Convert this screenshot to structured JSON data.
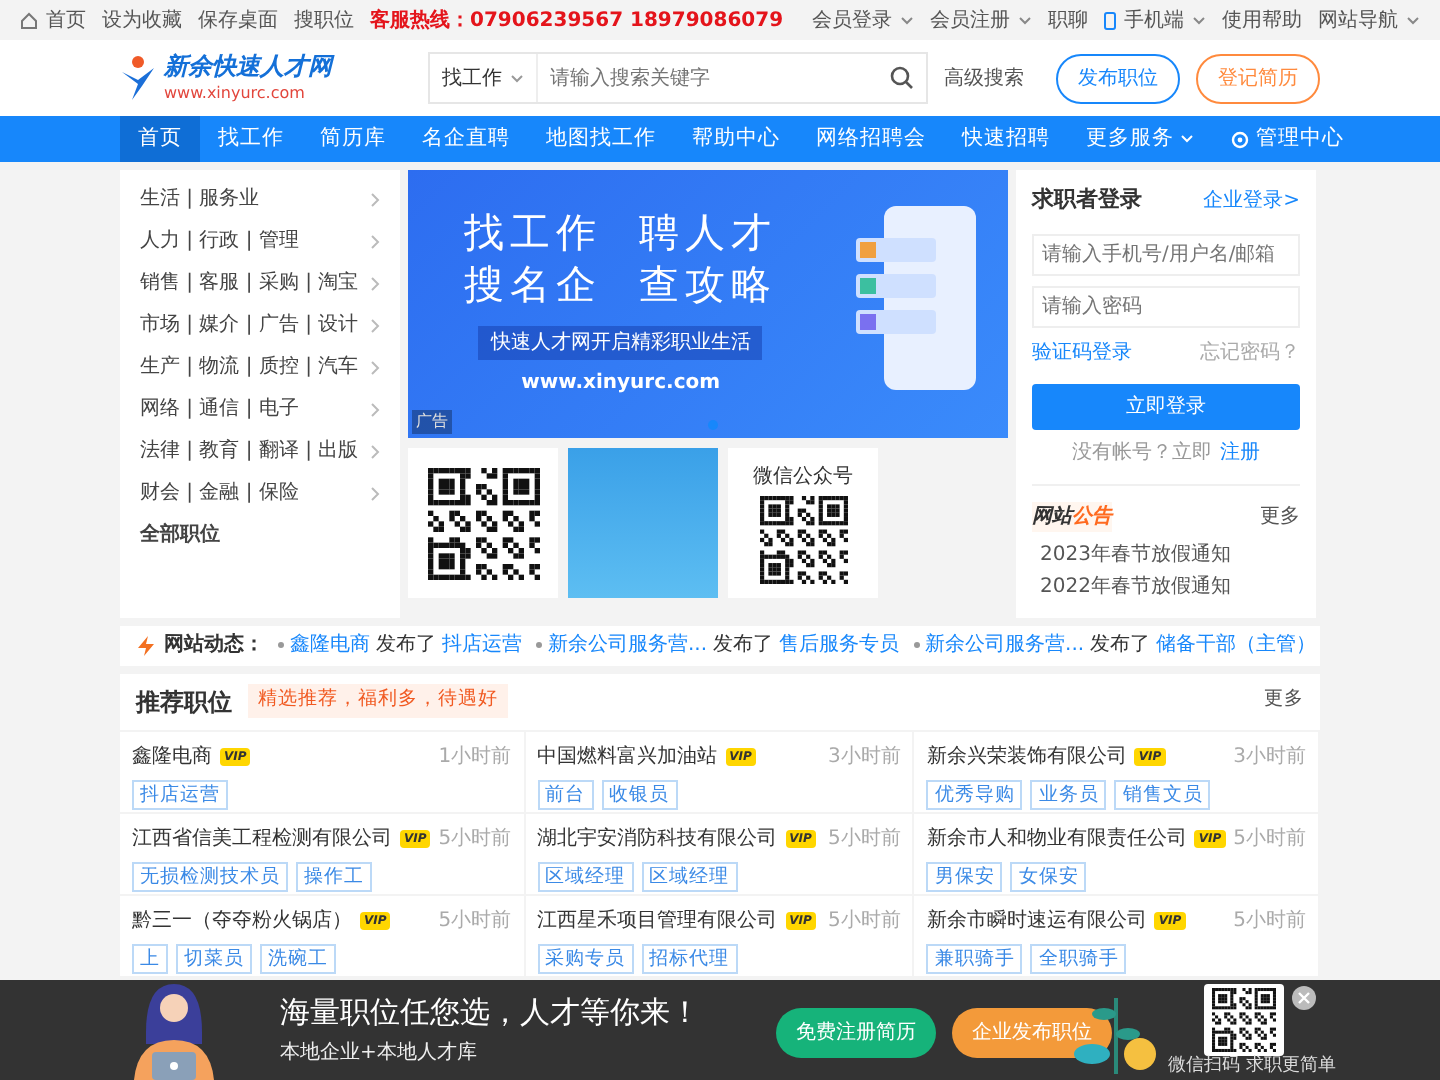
{
  "top_bar": {
    "left_links": [
      {
        "label": "首页"
      },
      {
        "label": "设为收藏"
      },
      {
        "label": "保存桌面"
      },
      {
        "label": "搜职位"
      }
    ],
    "hotline": "客服热线：07906239567 18979086079",
    "right_links": [
      {
        "label": "会员登录",
        "dropdown": true
      },
      {
        "label": "会员注册",
        "dropdown": true
      },
      {
        "label": "职聊",
        "dropdown": false
      },
      {
        "label": "手机端",
        "dropdown": true
      },
      {
        "label": "使用帮助",
        "dropdown": false
      },
      {
        "label": "网站导航",
        "dropdown": true
      }
    ]
  },
  "header": {
    "logo_name": "新余快速人才网",
    "logo_url": "www.xinyurc.com",
    "search_type": "找工作",
    "search_placeholder": "请输入搜索关键字",
    "advanced": "高级搜索",
    "buttons": [
      {
        "label": "发布职位",
        "kind": "primary"
      },
      {
        "label": "登记简历",
        "kind": "warning"
      }
    ]
  },
  "nav": {
    "items": [
      {
        "label": "首页",
        "selected": true
      },
      {
        "label": "找工作",
        "selected": false
      },
      {
        "label": "简历库",
        "selected": false
      },
      {
        "label": "名企直聘",
        "selected": false
      },
      {
        "label": "地图找工作",
        "selected": false
      },
      {
        "label": "帮助中心",
        "selected": false
      },
      {
        "label": "网络招聘会",
        "selected": false
      },
      {
        "label": "快速招聘",
        "selected": false
      },
      {
        "label": "更多服务",
        "selected": false,
        "dropdown": true
      }
    ],
    "admin": "管理中心"
  },
  "categories": [
    {
      "label": "生活 | 服务业",
      "kind": "arrow"
    },
    {
      "label": "人力 | 行政 | 管理",
      "kind": "arrow"
    },
    {
      "label": "销售 | 客服 | 采购 | 淘宝",
      "kind": "arrow"
    },
    {
      "label": "市场 | 媒介 | 广告 | 设计",
      "kind": "arrow"
    },
    {
      "label": "生产 | 物流 | 质控 | 汽车",
      "kind": "arrow"
    },
    {
      "label": "网络 | 通信 | 电子",
      "kind": "arrow"
    },
    {
      "label": "法律 | 教育 | 翻译 | 出版",
      "kind": "arrow"
    },
    {
      "label": "财会 | 金融 | 保险",
      "kind": "arrow"
    },
    {
      "label": "全部职位",
      "kind": "all"
    }
  ],
  "banner": {
    "lines": [
      "找工作  聘人才",
      "搜名企  查攻略"
    ],
    "slogan": "快速人才网开启精彩职业生活",
    "url": "www.xinyurc.com",
    "ad_tag": "广告",
    "dots": [
      {
        "selected": true
      }
    ]
  },
  "ads": [
    {
      "kind": "qr"
    },
    {
      "kind": "promo"
    },
    {
      "kind": "qr",
      "caption": "微信公众号"
    }
  ],
  "login": {
    "title": "求职者登录",
    "company_link": "企业登录>",
    "user_placeholder": "请输入手机号/用户名/邮箱",
    "password_placeholder": "请输入密码",
    "code_login": "验证码登录",
    "forgot": "忘记密码？",
    "submit": "立即登录",
    "no_account": "没有帐号？立即",
    "register": "注册"
  },
  "notice": {
    "title_a": "网站",
    "title_b": "公告",
    "more": "更多",
    "items": [
      "2023年春节放假通知",
      "2022年春节放假通知"
    ]
  },
  "ticker": {
    "label": "网站动态：",
    "items": [
      {
        "company": "鑫隆电商",
        "verb": "发布了",
        "job": "抖店运营"
      },
      {
        "company": "新余公司服务营...",
        "verb": "发布了",
        "job": "售后服务专员"
      },
      {
        "company": "新余公司服务营...",
        "verb": "发布了",
        "job": "储备干部（主管）"
      }
    ]
  },
  "recommended": {
    "title": "推荐职位",
    "tag": "精选推荐，福利多，待遇好",
    "more": "更多",
    "jobs": [
      {
        "company": "鑫隆电商",
        "badge": "VIP",
        "time": "1小时前",
        "tags": [
          "抖店运营"
        ]
      },
      {
        "company": "中国燃料富兴加油站",
        "badge": "VIP",
        "time": "3小时前",
        "tags": [
          "前台",
          "收银员"
        ]
      },
      {
        "company": "新余兴荣装饰有限公司",
        "badge": "VIP",
        "time": "3小时前",
        "tags": [
          "优秀导购",
          "业务员",
          "销售文员"
        ]
      },
      {
        "company": "江西省信美工程检测有限公司",
        "badge": "VIP",
        "time": "5小时前",
        "tags": [
          "无损检测技术员",
          "操作工"
        ]
      },
      {
        "company": "湖北宇安消防科技有限公司",
        "badge": "VIP",
        "time": "5小时前",
        "tags": [
          "区域经理",
          "区域经理"
        ]
      },
      {
        "company": "新余市人和物业有限责任公司",
        "badge": "VIP",
        "time": "5小时前",
        "tags": [
          "男保安",
          "女保安"
        ]
      },
      {
        "company": "黔三一（夺夺粉火锅店）",
        "badge": "VIP",
        "time": "5小时前",
        "tags": [
          "上",
          "切菜员",
          "洗碗工"
        ]
      },
      {
        "company": "江西星禾项目管理有限公司",
        "badge": "VIP",
        "time": "5小时前",
        "tags": [
          "采购专员",
          "招标代理"
        ]
      },
      {
        "company": "新余市瞬时速运有限公司",
        "badge": "VIP",
        "time": "5小时前",
        "tags": [
          "兼职骑手",
          "全职骑手"
        ]
      }
    ]
  },
  "bottom_bar": {
    "headline": "海量职位任您选，人才等你来！",
    "sub": "本地企业+本地人才库",
    "buttons": [
      {
        "label": "免费注册简历",
        "kind": "success"
      },
      {
        "label": "企业发布职位",
        "kind": "warning"
      }
    ],
    "qr_caption": "微信扫码 求职更简单"
  }
}
